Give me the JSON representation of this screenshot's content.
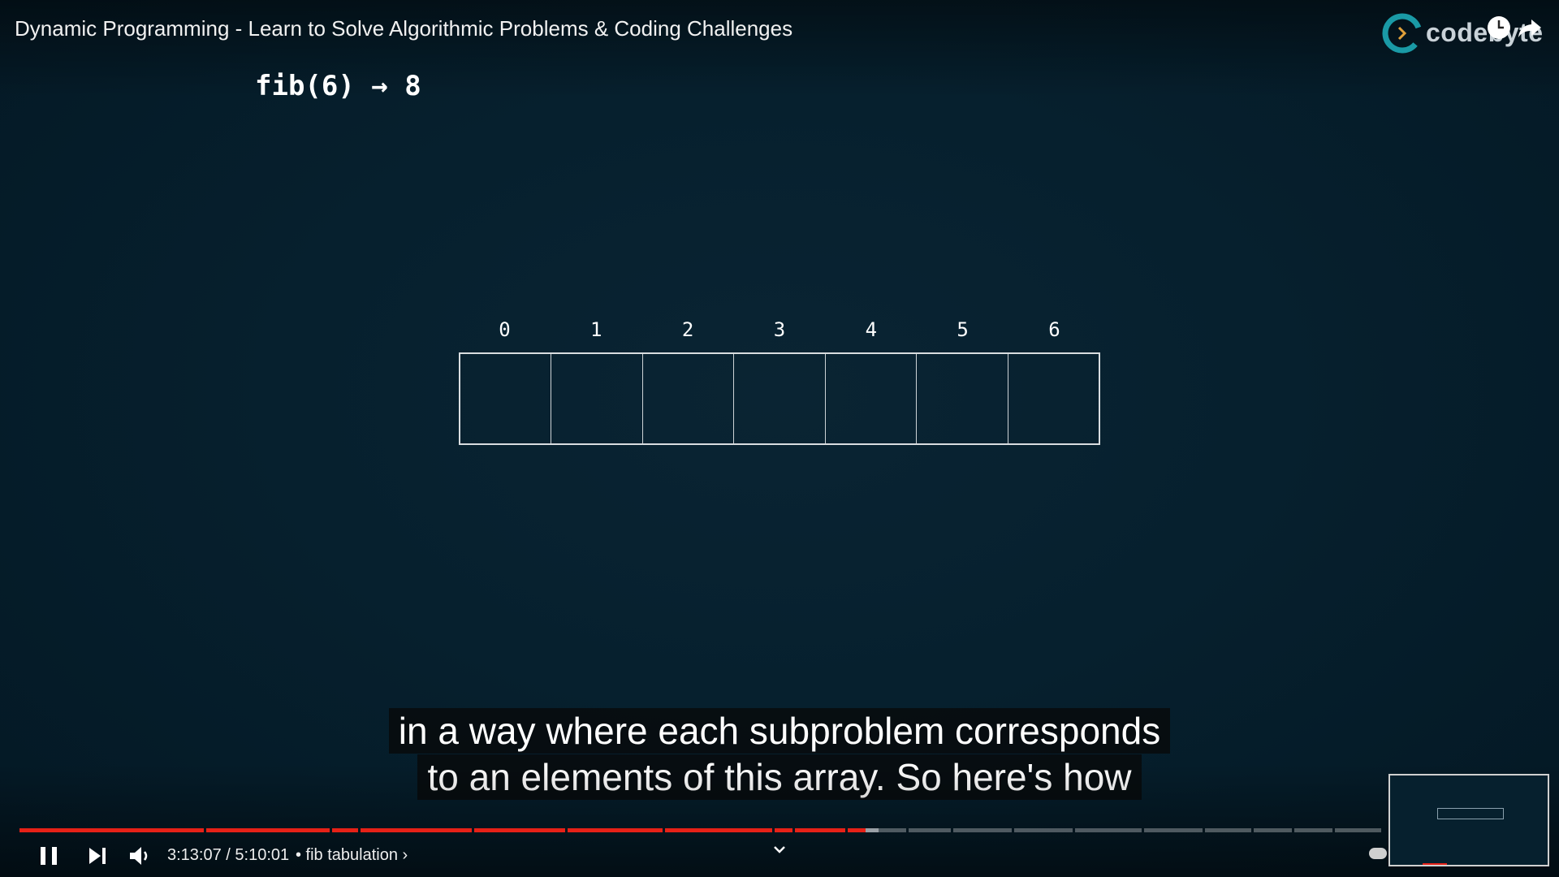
{
  "video": {
    "title": "Dynamic Programming - Learn to Solve Algorithmic Problems & Coding Challenges",
    "channel_brand": "codebyte"
  },
  "slide": {
    "heading": "fib(6) → 8",
    "array_indices": [
      "0",
      "1",
      "2",
      "3",
      "4",
      "5",
      "6"
    ]
  },
  "captions": {
    "line1": "in a way where each subproblem corresponds",
    "line2": "to an elements of this array. So here's how"
  },
  "player": {
    "current_time": "3:13:07",
    "duration": "5:10:01",
    "time_display": "3:13:07 / 5:10:01",
    "chapter_label": "• fib tabulation ›",
    "progress_played_fraction": 0.62,
    "progress_buffered_fraction": 0.63,
    "accent_color": "#e62117",
    "icons": [
      "pause-icon",
      "next-icon",
      "volume-icon",
      "chevron-down-icon",
      "clock-icon",
      "share-icon"
    ]
  }
}
